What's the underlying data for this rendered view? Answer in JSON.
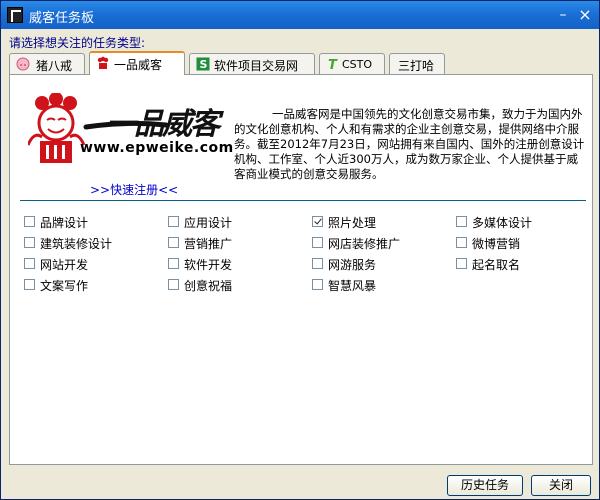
{
  "window": {
    "title": "威客任务板",
    "minimize": "–",
    "close": "×"
  },
  "prompt": "请选择想关注的任务类型:",
  "tabs": [
    {
      "label": "猪八戒",
      "icon": "pig-icon",
      "active": false
    },
    {
      "label": "一品威客",
      "icon": "epweike-icon",
      "active": true
    },
    {
      "label": "软件项目交易网",
      "icon": "s-leaf-icon",
      "active": false
    },
    {
      "label": "CSTO",
      "icon": "t-icon",
      "active": false
    },
    {
      "label": "三打哈",
      "icon": "",
      "active": false
    }
  ],
  "panel": {
    "logo_text": "一品威客",
    "site_url": "www.epweike.com",
    "description": "一品威客网是中国领先的文化创意交易市集，致力于为国内外的文化创意机构、个人和有需求的企业主创意交易，提供网络中介服务。截至2012年7月23日，网站拥有来自国内、国外的注册创意设计机构、工作室、个人近300万人，成为数万家企业、个人提供基于威客商业模式的创意交易服务。",
    "quick_register": ">>快速注册<<"
  },
  "options": [
    {
      "label": "品牌设计",
      "checked": false
    },
    {
      "label": "应用设计",
      "checked": false
    },
    {
      "label": "照片处理",
      "checked": true
    },
    {
      "label": "多媒体设计",
      "checked": false
    },
    {
      "label": "建筑装修设计",
      "checked": false
    },
    {
      "label": "营销推广",
      "checked": false
    },
    {
      "label": "网店装修推广",
      "checked": false
    },
    {
      "label": "微博营销",
      "checked": false
    },
    {
      "label": "网站开发",
      "checked": false
    },
    {
      "label": "软件开发",
      "checked": false
    },
    {
      "label": "网游服务",
      "checked": false
    },
    {
      "label": "起名取名",
      "checked": false
    },
    {
      "label": "文案写作",
      "checked": false
    },
    {
      "label": "创意祝福",
      "checked": false
    },
    {
      "label": "智慧风暴",
      "checked": false
    }
  ],
  "buttons": {
    "history": "历史任务",
    "close": "关闭"
  },
  "colors": {
    "titlebar": "#1a6fd6",
    "tab_active_accent": "#e68b2c",
    "link": "#0000cc",
    "logo_red": "#d0131b"
  }
}
